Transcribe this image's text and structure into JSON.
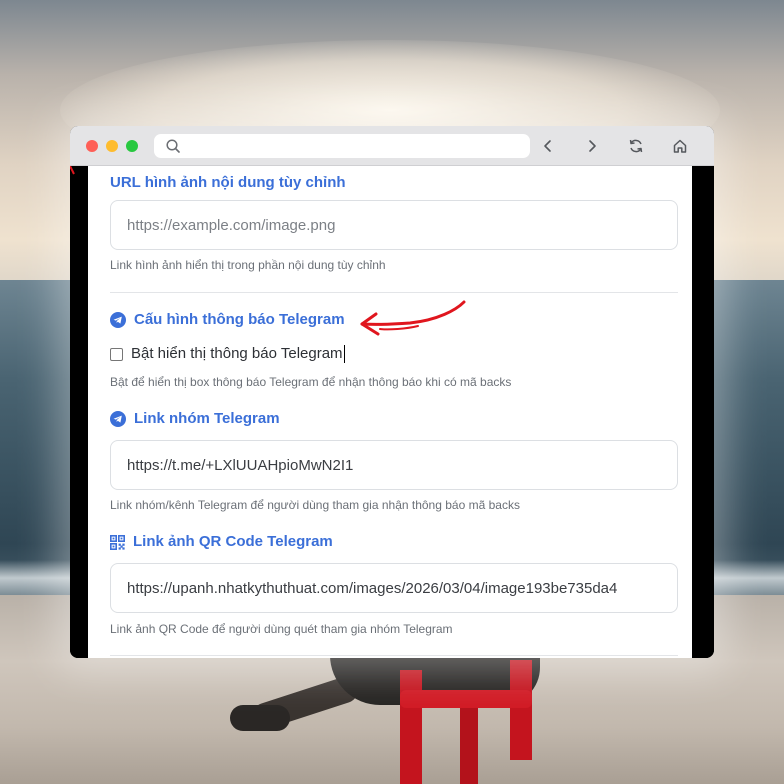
{
  "window": {
    "url": ""
  },
  "content": {
    "custom_image": {
      "heading": "URL hình ảnh nội dung tùy chỉnh",
      "placeholder": "https://example.com/image.png",
      "help": "Link hình ảnh hiển thị trong phần nội dung tùy chỉnh"
    },
    "telegram_config": {
      "heading": "Cấu hình thông báo Telegram",
      "icon": "telegram-icon",
      "checkbox_label": "Bật hiển thị thông báo Telegram",
      "checkbox_checked": false,
      "help": "Bật để hiển thị box thông báo Telegram để nhận thông báo khi có mã backs"
    },
    "telegram_group": {
      "heading": "Link nhóm Telegram",
      "icon": "telegram-icon",
      "value": "https://t.me/+LXlUUAHpioMwN2I1",
      "help": "Link nhóm/kênh Telegram để người dùng tham gia nhận thông báo mã backs"
    },
    "telegram_qr": {
      "heading": "Link ảnh QR Code Telegram",
      "icon": "qr-code-icon",
      "value": "https://upanh.nhatkythuthuat.com/images/2026/03/04/image193be735da4",
      "help": "Link ảnh QR Code để người dùng quét tham gia nhóm Telegram"
    }
  },
  "colors": {
    "accent": "#3b6fd8",
    "annotation": "#e0161e"
  }
}
